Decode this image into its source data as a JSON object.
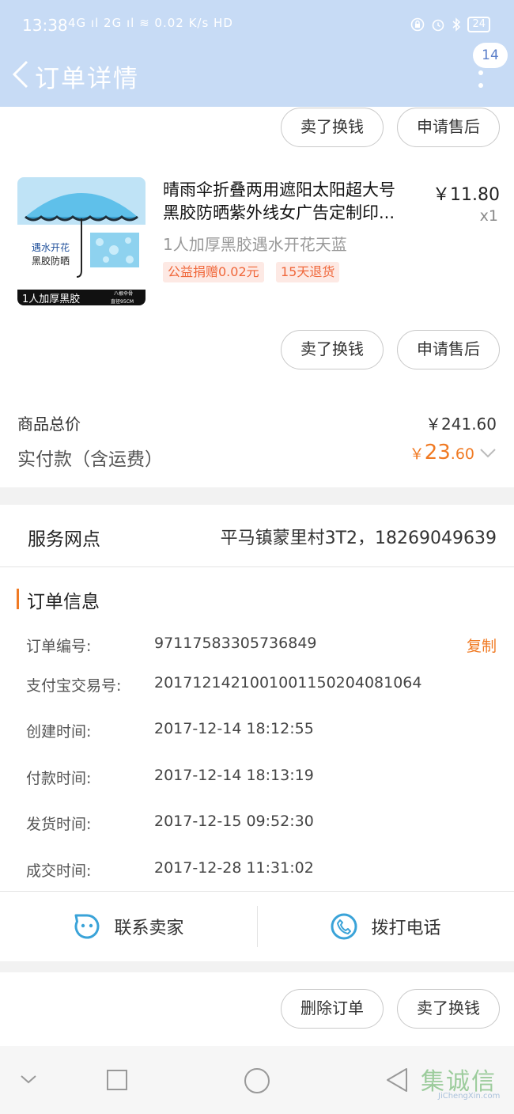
{
  "status_bar": {
    "time": "13:38",
    "network": "4G ıl 2G ıl ≋ 0.02 K/s HD",
    "battery": "24"
  },
  "header": {
    "title": "订单详情",
    "badge_count": "14"
  },
  "top_buttons": {
    "sell_label": "卖了换钱",
    "aftersale_label": "申请售后"
  },
  "product": {
    "title_line1": "晴雨伞折叠两用遮阳太阳超大号",
    "title_line2": "黑胶防晒紫外线女广告定制印...",
    "price": "￥11.80",
    "quantity": "x1",
    "sku": "1人加厚黑胶遇水开花天蓝",
    "tags": [
      "公益捐赠0.02元",
      "15天退货"
    ],
    "image_text": {
      "side1": "遇水开花",
      "side2": "黑胶防晒",
      "band": "1人加厚黑胶",
      "small1": "八根伞骨",
      "small2": "直径95CM"
    },
    "sell_label": "卖了换钱",
    "aftersale_label": "申请售后"
  },
  "totals": {
    "goods_total_label": "商品总价",
    "goods_total_value": "￥241.60",
    "paid_label": "实付款（含运费）",
    "paid_currency": "￥",
    "paid_integer": "23",
    "paid_decimal": ".60"
  },
  "service_point": {
    "label": "服务网点",
    "value": "平马镇蒙里村3T2，18269049639"
  },
  "order_info": {
    "title": "订单信息",
    "copy_label": "复制",
    "rows": [
      {
        "label": "订单编号:",
        "value": "97117583305736849"
      },
      {
        "label": "支付宝交易号:",
        "value": "2017121421001001150204081064"
      },
      {
        "label": "创建时间:",
        "value": "2017-12-14 18:12:55"
      },
      {
        "label": "付款时间:",
        "value": "2017-12-14 18:13:19"
      },
      {
        "label": "发货时间:",
        "value": "2017-12-15 09:52:30"
      },
      {
        "label": "成交时间:",
        "value": "2017-12-28 11:31:02"
      }
    ]
  },
  "contact": {
    "seller_label": "联系卖家",
    "phone_label": "拨打电话"
  },
  "bottom_buttons": {
    "delete_label": "删除订单",
    "sell_label": "卖了换钱"
  },
  "watermark": {
    "cn": "集诚信",
    "en": "JiChengXin.com"
  },
  "colors": {
    "header_bg": "#c7dbf5",
    "accent_orange": "#f07a23",
    "icon_blue": "#3aa3d8"
  }
}
